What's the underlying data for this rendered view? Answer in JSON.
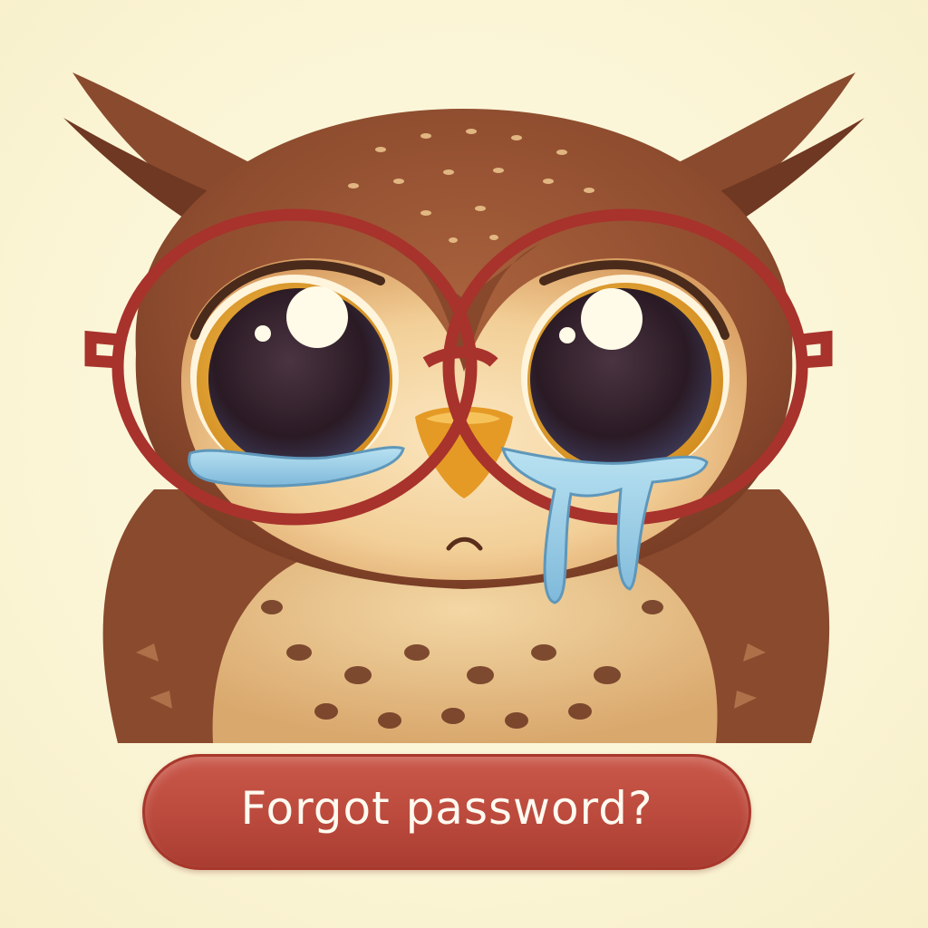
{
  "button": {
    "label": "Forgot password?"
  },
  "icons": {
    "mascot": "crying-owl-with-glasses-icon"
  },
  "colors": {
    "background": "#fbf6d9",
    "button_fill": "#bb4a3d",
    "button_text": "#fffaf0",
    "glasses_frame": "#a8322c",
    "feather_brown": "#8f4d2f",
    "beak": "#e59a25",
    "tear": "#8ec9e6"
  }
}
